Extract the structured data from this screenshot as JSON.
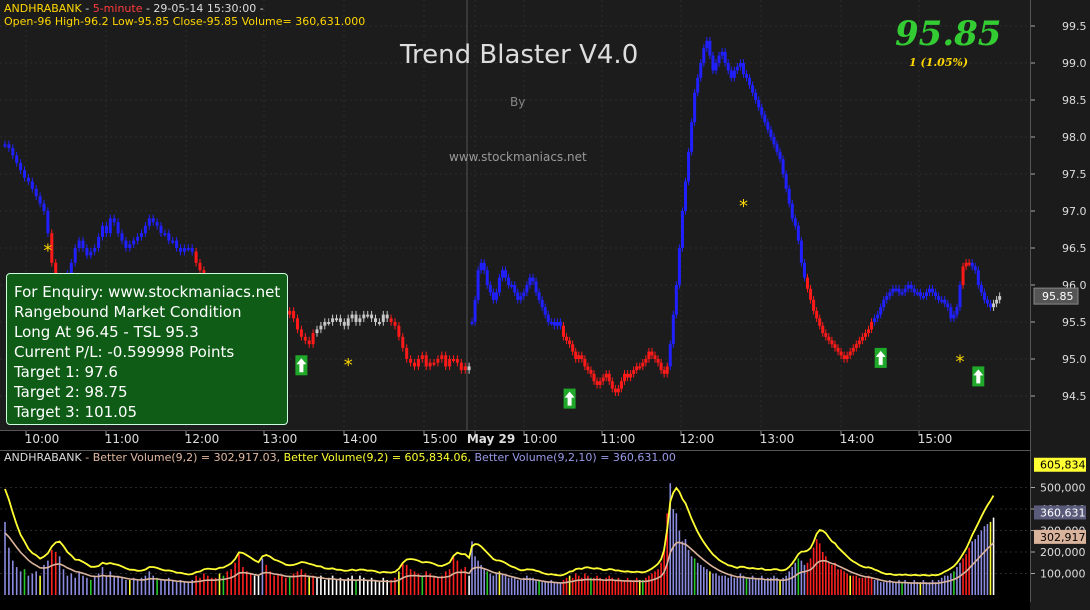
{
  "header": {
    "symbol": "ANDHRABANK",
    "sep1": " - ",
    "interval": "5-minute",
    "sep2": " - 29-05-14 15:30:00 -",
    "ohlc": "Open-96  High-96.2  Low-95.85  Close-95.85  Volume= 360,631.000"
  },
  "title": "Trend Blaster V4.0",
  "by_text": "By",
  "site": "www.stockmaniacs.net",
  "last_price": "95.85",
  "change": "1  (1.05%)",
  "enquiry_box": {
    "line1": "For Enquiry: www.stockmaniacs.net",
    "line2": "Rangebound Market Condition",
    "line3": "Long At 96.45 - TSL 95.3",
    "line4": "Current P/L: -0.599998 Points",
    "line5": "Target 1: 97.6",
    "line6": "Target 2: 98.75",
    "line7": "Target 3: 101.05"
  },
  "volume_header": {
    "symbol": "ANDHRABANK",
    "part1": " - Better Volume(9,2) = 302,917.03, ",
    "part2": "Better Volume(9,2) = 605,834.06, ",
    "part3": "Better Volume(9,2,10) = 360,631.00"
  },
  "colors": {
    "bull": "#2020ff",
    "bear": "#ff1a1a",
    "neutral": "#c8c8c8",
    "signal_star": "#ffd700",
    "buy_arrow_bg": "#1fa82a",
    "price_axis_bg": "#1b1b1b",
    "volume_line1": "#ffff33",
    "volume_line2": "#d9b39b"
  },
  "chart_data": {
    "type": "candlestick",
    "price_axis": {
      "ticks": [
        "99.5",
        "99.0",
        "98.5",
        "98.0",
        "97.5",
        "97.0",
        "96.5",
        "96.0",
        "95.5",
        "95.0",
        "94.5"
      ],
      "ylim": [
        94.2,
        99.7
      ],
      "last_label": "95.85"
    },
    "time_axis": {
      "labels": [
        "10:00",
        "11:00",
        "12:00",
        "13:00",
        "14:00",
        "15:00",
        "May 29",
        "10:00",
        "11:00",
        "12:00",
        "13:00",
        "14:00",
        "15:00"
      ]
    },
    "day1": {
      "colors": "BBBBBBBBBBBBRRBBBBBBBBBBBBBBBBBBBBBBBBBBBBBBBBBBBRRRRRRRRRRRRRRRNNBRRRRRRRRRRRRRNNNNNNNNNNNNNNNNNNNRRRRRRRRRRRRRRRRRRRR",
      "close": [
        97.9,
        97.85,
        97.75,
        97.65,
        97.55,
        97.45,
        97.4,
        97.3,
        97.2,
        97.1,
        97.0,
        96.7,
        96.3,
        96.0,
        95.9,
        96.1,
        96.15,
        96.3,
        96.5,
        96.6,
        96.5,
        96.4,
        96.45,
        96.5,
        96.65,
        96.8,
        96.7,
        96.9,
        96.85,
        96.7,
        96.6,
        96.5,
        96.55,
        96.6,
        96.65,
        96.7,
        96.8,
        96.9,
        96.85,
        96.8,
        96.7,
        96.7,
        96.6,
        96.6,
        96.5,
        96.45,
        96.5,
        96.5,
        96.45,
        96.3,
        96.2,
        96.05,
        95.95,
        95.9,
        95.85,
        95.8,
        95.75,
        95.7,
        95.6,
        95.55,
        95.4,
        95.5,
        95.55,
        95.5,
        95.45,
        95.5,
        95.7,
        95.8,
        95.6,
        95.45,
        95.4,
        95.5,
        95.6,
        95.65,
        95.55,
        95.4,
        95.3,
        95.25,
        95.2,
        95.35,
        95.4,
        95.45,
        95.5,
        95.5,
        95.55,
        95.55,
        95.5,
        95.45,
        95.55,
        95.6,
        95.5,
        95.55,
        95.6,
        95.6,
        95.55,
        95.5,
        95.5,
        95.6,
        95.55,
        95.5,
        95.45,
        95.3,
        95.15,
        95.0,
        94.95,
        94.9,
        95.0,
        95.05,
        94.9,
        94.95,
        94.95,
        95.0,
        95.05,
        94.9,
        95.0,
        95.0,
        94.95,
        94.85,
        94.9,
        94.85
      ],
      "vol": [
        340,
        220,
        160,
        130,
        110,
        120,
        90,
        100,
        110,
        90,
        140,
        160,
        210,
        200,
        180,
        120,
        90,
        100,
        80,
        110,
        90,
        80,
        70,
        90,
        100,
        130,
        90,
        110,
        90,
        90,
        80,
        70,
        70,
        80,
        70,
        80,
        90,
        110,
        90,
        80,
        70,
        70,
        80,
        70,
        60,
        70,
        60,
        60,
        70,
        90,
        80,
        100,
        90,
        80,
        80,
        100,
        90,
        110,
        120,
        150,
        190,
        130,
        110,
        100,
        90,
        90,
        170,
        140,
        110,
        90,
        100,
        90,
        80,
        90,
        100,
        110,
        120,
        100,
        90,
        90,
        80,
        90,
        70,
        80,
        90,
        70,
        80,
        70,
        80,
        90,
        70,
        90,
        80,
        70,
        80,
        70,
        60,
        80,
        70,
        70,
        80,
        110,
        150,
        140,
        120,
        110,
        100,
        90,
        110,
        100,
        90,
        80,
        90,
        110,
        120,
        180,
        160,
        120,
        130,
        90
      ]
    },
    "day2": {
      "colors": "BBBBBBBBBBBBBBBBBBBBBBBBBBBBBBRRRRRRRRRRRRRRRRRRRRRRRRRRRRRRRRRRRBBBBBBBBBBBBBBBBBBBBBBBBBBBBBBBBBBBBBBBBBBBBBRRRRRRRRRRRRRRRRRRRRRRBBBBBBBBBBBBBBBBBBBBBBBBBBBBBRRRBBBBBBBNNNNNNNNN",
      "close": [
        95.5,
        95.8,
        96.2,
        96.3,
        96.2,
        96.0,
        95.9,
        95.8,
        95.9,
        96.1,
        96.2,
        96.1,
        96.0,
        96.0,
        95.9,
        95.8,
        95.85,
        95.9,
        96.0,
        96.1,
        96.05,
        95.9,
        95.8,
        95.7,
        95.6,
        95.5,
        95.5,
        95.45,
        95.5,
        95.45,
        95.3,
        95.25,
        95.2,
        95.1,
        95.0,
        95.05,
        95.0,
        94.9,
        94.85,
        94.8,
        94.7,
        94.65,
        94.7,
        94.75,
        94.8,
        94.7,
        94.6,
        94.55,
        94.6,
        94.7,
        94.8,
        94.75,
        94.8,
        94.85,
        94.9,
        94.9,
        94.95,
        95.0,
        95.1,
        95.05,
        95.0,
        94.95,
        94.85,
        94.8,
        94.9,
        95.2,
        95.6,
        96.0,
        96.5,
        97.0,
        97.4,
        97.8,
        98.2,
        98.6,
        98.8,
        99.0,
        99.2,
        99.3,
        99.1,
        98.9,
        99.0,
        99.1,
        99.15,
        99.0,
        98.9,
        98.8,
        98.9,
        98.95,
        99.0,
        98.85,
        98.8,
        98.7,
        98.6,
        98.5,
        98.4,
        98.3,
        98.2,
        98.1,
        98.0,
        97.9,
        97.8,
        97.7,
        97.5,
        97.3,
        97.1,
        96.9,
        96.8,
        96.6,
        96.3,
        96.1,
        95.95,
        95.8,
        95.65,
        95.55,
        95.45,
        95.35,
        95.3,
        95.25,
        95.2,
        95.15,
        95.1,
        95.05,
        95.0,
        95.05,
        95.1,
        95.15,
        95.2,
        95.25,
        95.3,
        95.35,
        95.4,
        95.5,
        95.55,
        95.6,
        95.7,
        95.8,
        95.85,
        95.9,
        95.95,
        95.95,
        95.9,
        95.9,
        95.95,
        96.0,
        95.95,
        95.9,
        95.9,
        95.85,
        95.85,
        95.9,
        95.95,
        95.9,
        95.85,
        95.8,
        95.8,
        95.75,
        95.7,
        95.55,
        95.6,
        95.7,
        96.0,
        96.25,
        96.3,
        96.3,
        96.25,
        96.2,
        96.0,
        95.9,
        95.8,
        95.75,
        95.7,
        95.75,
        95.8,
        95.85
      ],
      "vol": [
        250,
        180,
        160,
        140,
        120,
        110,
        100,
        90,
        100,
        110,
        100,
        90,
        80,
        80,
        80,
        70,
        70,
        80,
        90,
        80,
        80,
        70,
        70,
        60,
        60,
        60,
        70,
        60,
        60,
        60,
        70,
        80,
        90,
        80,
        100,
        90,
        80,
        100,
        90,
        80,
        80,
        90,
        80,
        70,
        80,
        90,
        80,
        70,
        80,
        70,
        70,
        80,
        70,
        70,
        80,
        70,
        70,
        80,
        90,
        100,
        110,
        120,
        150,
        220,
        380,
        520,
        400,
        380,
        300,
        250,
        260,
        210,
        180,
        170,
        150,
        140,
        130,
        120,
        110,
        100,
        100,
        90,
        90,
        90,
        80,
        90,
        80,
        80,
        100,
        90,
        80,
        80,
        90,
        80,
        80,
        90,
        70,
        80,
        80,
        90,
        80,
        70,
        80,
        90,
        110,
        130,
        150,
        170,
        160,
        140,
        150,
        170,
        220,
        260,
        240,
        200,
        180,
        150,
        140,
        150,
        120,
        120,
        110,
        100,
        90,
        90,
        90,
        80,
        80,
        80,
        90,
        80,
        70,
        70,
        60,
        60,
        60,
        70,
        60,
        60,
        70,
        60,
        70,
        60,
        60,
        70,
        60,
        60,
        70,
        60,
        60,
        70,
        60,
        70,
        80,
        90,
        90,
        100,
        110,
        130,
        150,
        170,
        190,
        220,
        250,
        260,
        280,
        300,
        320,
        330,
        340,
        360
      ]
    },
    "signals": {
      "stars": [
        {
          "day": 1,
          "i": 11,
          "price": 96.55
        },
        {
          "day": 1,
          "i": 88,
          "price": 95.0
        },
        {
          "day": 2,
          "i": 89,
          "price": 97.15
        },
        {
          "day": 2,
          "i": 160,
          "price": 95.05
        }
      ],
      "arrows": [
        {
          "day": 1,
          "i": 76,
          "price": 95.05
        },
        {
          "day": 2,
          "i": 32,
          "price": 94.6
        },
        {
          "day": 2,
          "i": 134,
          "price": 95.15
        },
        {
          "day": 2,
          "i": 166,
          "price": 94.9
        }
      ]
    },
    "volume_axis": {
      "ticks": [
        "500,000",
        "400,000",
        "300,000",
        "200,000",
        "100,000"
      ],
      "ylim": [
        0,
        700000
      ],
      "labels": [
        "605,834",
        "360,631",
        "302,917"
      ]
    }
  }
}
